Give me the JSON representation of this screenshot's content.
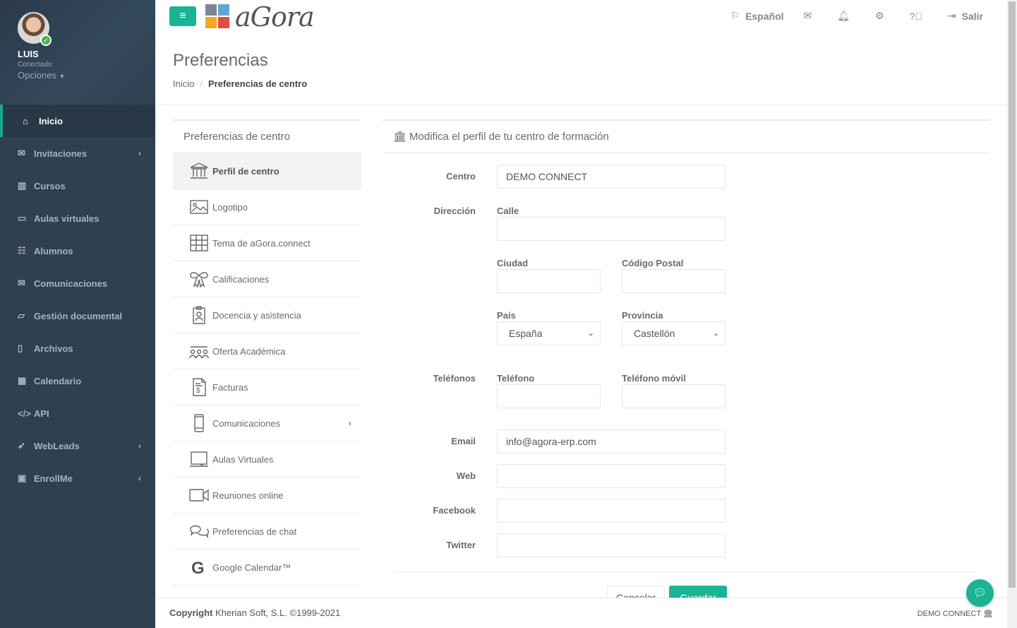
{
  "app": {
    "logo_text": "aGora",
    "menu_button": "≡"
  },
  "user": {
    "name": "LUIS",
    "status": "Conectado",
    "options_label": "Opciones"
  },
  "sidebar": {
    "items": [
      {
        "label": "Inicio",
        "icon": "⌂",
        "active": true
      },
      {
        "label": "Invitaciones",
        "icon": "✉",
        "arrow": "‹"
      },
      {
        "label": "Cursos",
        "icon": "▥",
        "arrow": ""
      },
      {
        "label": "Aulas virtuales",
        "icon": "▭",
        "arrow": ""
      },
      {
        "label": "Alumnos",
        "icon": "☷",
        "arrow": ""
      },
      {
        "label": "Comunicaciones",
        "icon": "✉",
        "arrow": ""
      },
      {
        "label": "Gestión documental",
        "icon": "▱",
        "arrow": ""
      },
      {
        "label": "Archivos",
        "icon": "▯",
        "arrow": ""
      },
      {
        "label": "Calendario",
        "icon": "▦",
        "arrow": ""
      },
      {
        "label": "API",
        "icon": "</>",
        "arrow": ""
      },
      {
        "label": "WebLeads",
        "icon": "➶",
        "arrow": "‹"
      },
      {
        "label": "EnrollMe",
        "icon": "▣",
        "arrow": "‹"
      }
    ]
  },
  "topbar": {
    "language": "Español",
    "logout": "Salir"
  },
  "page": {
    "title": "Preferencias",
    "breadcrumb_home": "Inicio",
    "breadcrumb_sep": "/",
    "breadcrumb_current": "Preferencias de centro"
  },
  "left_panel": {
    "title": "Preferencias de centro",
    "items": [
      {
        "label": "Perfil de centro",
        "icon": "bank-icon"
      },
      {
        "label": "Logotipo",
        "icon": "image-icon"
      },
      {
        "label": "Tema de aGora.connect",
        "icon": "grid-icon"
      },
      {
        "label": "Calificaciones",
        "icon": "ribbon-icon"
      },
      {
        "label": "Docencia y asistencia",
        "icon": "badge-icon"
      },
      {
        "label": "Oferta Académica",
        "icon": "group-icon"
      },
      {
        "label": "Facturas",
        "icon": "invoice-icon"
      },
      {
        "label": "Comunicaciones",
        "icon": "phone-icon",
        "arrow": "‹"
      },
      {
        "label": "Aulas Virtuales",
        "icon": "laptop-icon"
      },
      {
        "label": "Reuniones online",
        "icon": "video-icon"
      },
      {
        "label": "Preferencias de chat",
        "icon": "chat-icon"
      },
      {
        "label": "Google Calendar™",
        "icon": "google-icon"
      }
    ]
  },
  "form": {
    "title": "Modifica el perfil de tu centro de formación",
    "centro_label": "Centro",
    "centro_value": "DEMO CONNECT",
    "direccion_label": "Dirección",
    "calle_label": "Calle",
    "calle_value": "",
    "ciudad_label": "Ciudad",
    "ciudad_value": "",
    "cp_label": "Código Postal",
    "cp_value": "",
    "pais_label": "País",
    "pais_value": "España",
    "provincia_label": "Provincia",
    "provincia_value": "Castellón",
    "telefonos_label": "Teléfonos",
    "telefono_label": "Teléfono",
    "telefono_value": "",
    "movil_label": "Teléfono móvil",
    "movil_value": "",
    "email_label": "Email",
    "email_value": "info@agora-erp.com",
    "web_label": "Web",
    "web_value": "",
    "facebook_label": "Facebook",
    "facebook_value": "",
    "twitter_label": "Twitter",
    "twitter_value": "",
    "cancel_label": "Cancelar",
    "save_label": "Guardar"
  },
  "footer": {
    "copyright_bold": "Copyright",
    "copyright_text": " Kherian Soft, S.L. ©1999-2021",
    "right_text": "DEMO CONNECT"
  },
  "colors": {
    "accent": "#1ab394",
    "sidebar": "#2f4050"
  }
}
